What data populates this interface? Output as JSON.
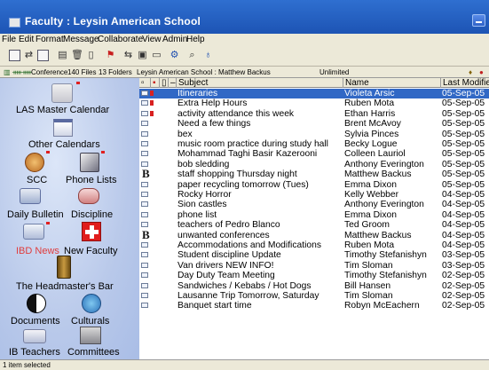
{
  "window": {
    "title": "Faculty : Leysin American School"
  },
  "menu": [
    "File",
    "Edit",
    "Format",
    "Message",
    "Collaborate",
    "View",
    "Admin",
    "Help"
  ],
  "toolbar": {
    "icons": [
      "new-message-icon",
      "reply-icon",
      "forward-icon",
      "print-icon",
      "delete-icon",
      "file-icon",
      "flag-icon",
      "move-icon",
      "archive-icon",
      "folder-icon",
      "settings-icon",
      "search-icon",
      "filter-icon"
    ]
  },
  "status": {
    "conference_label": "Conference",
    "files": "140 Files",
    "folders": "13 Folders",
    "location": "Leysin American School : Matthew Backus",
    "limit": "Unlimited"
  },
  "sidebar": {
    "items": [
      {
        "label": "LAS Master Calendar",
        "icon": "calendar-icon"
      },
      {
        "label": "Other Calendars",
        "icon": "calendar-icon"
      },
      {
        "label": "SCC",
        "icon": "medal-icon"
      },
      {
        "label": "Phone Lists",
        "icon": "phone-icon"
      },
      {
        "label": "Daily Bulletin",
        "icon": "bulletin-icon"
      },
      {
        "label": "Discipline",
        "icon": "discipline-icon"
      },
      {
        "label": "IBD News",
        "icon": "news-icon"
      },
      {
        "label": "New Faculty",
        "icon": "swiss-cross-icon"
      },
      {
        "label": "The Headmaster's Bar",
        "icon": "beer-icon"
      },
      {
        "label": "Documents",
        "icon": "yin-yang-icon"
      },
      {
        "label": "Culturals",
        "icon": "globe-icon"
      },
      {
        "label": "IB Teachers",
        "icon": "teachers-icon"
      },
      {
        "label": "Committees",
        "icon": "building-icon"
      }
    ],
    "highlight_color": "#e03c3c"
  },
  "list": {
    "columns": [
      "Subject",
      "Name",
      "Last Modifie"
    ],
    "rows": [
      {
        "subject": "Itineraries",
        "name": "Violeta Arsic",
        "date": "05-Sep-05",
        "selected": true,
        "flag": true,
        "type": "doc"
      },
      {
        "subject": "Extra Help Hours",
        "name": "Ruben Mota",
        "date": "05-Sep-05",
        "flag": true,
        "type": "doc"
      },
      {
        "subject": "activity attendance this week",
        "name": "Ethan Harris",
        "date": "05-Sep-05",
        "flag": true,
        "type": "doc"
      },
      {
        "subject": "Need a few things",
        "name": "Brent McAvoy",
        "date": "05-Sep-05",
        "type": "doc"
      },
      {
        "subject": "bex",
        "name": "Sylvia Pinces",
        "date": "05-Sep-05",
        "type": "doc"
      },
      {
        "subject": "music room practice during study hall",
        "name": "Becky Logue",
        "date": "05-Sep-05",
        "type": "doc"
      },
      {
        "subject": "Mohammad Taghi Basir Kazerooni",
        "name": "Colleen Lauriol",
        "date": "05-Sep-05",
        "type": "doc"
      },
      {
        "subject": "bob sledding",
        "name": "Anthony Everington",
        "date": "05-Sep-05",
        "type": "doc"
      },
      {
        "subject": "staff shopping Thursday night",
        "name": "Matthew Backus",
        "date": "05-Sep-05",
        "type": "b"
      },
      {
        "subject": "paper recycling tomorrow (Tues)",
        "name": "Emma Dixon",
        "date": "05-Sep-05",
        "type": "doc"
      },
      {
        "subject": "Rocky Horror",
        "name": "Kelly Webber",
        "date": "04-Sep-05",
        "type": "doc"
      },
      {
        "subject": "Sion castles",
        "name": "Anthony Everington",
        "date": "04-Sep-05",
        "type": "doc"
      },
      {
        "subject": "phone list",
        "name": "Emma Dixon",
        "date": "04-Sep-05",
        "type": "doc"
      },
      {
        "subject": "teachers of Pedro Blanco",
        "name": "Ted Groom",
        "date": "04-Sep-05",
        "type": "doc"
      },
      {
        "subject": "unwanted conferences",
        "name": "Matthew Backus",
        "date": "04-Sep-05",
        "type": "b"
      },
      {
        "subject": "Accommodations and Modifications",
        "name": "Ruben Mota",
        "date": "04-Sep-05",
        "type": "doc"
      },
      {
        "subject": "Student discipline Update",
        "name": "Timothy Stefanishyn",
        "date": "03-Sep-05",
        "type": "doc"
      },
      {
        "subject": "Van drivers NEW INFO!",
        "name": "Tim Sloman",
        "date": "03-Sep-05",
        "type": "doc"
      },
      {
        "subject": "Day Duty Team Meeting",
        "name": "Timothy Stefanishyn",
        "date": "02-Sep-05",
        "type": "doc"
      },
      {
        "subject": "Sandwiches / Kebabs / Hot Dogs",
        "name": "Bill Hansen",
        "date": "02-Sep-05",
        "type": "doc"
      },
      {
        "subject": "Lausanne Trip Tomorrow, Saturday",
        "name": "Tim Sloman",
        "date": "02-Sep-05",
        "type": "doc"
      },
      {
        "subject": "Banquet start time",
        "name": "Robyn McEachern",
        "date": "02-Sep-05",
        "type": "doc"
      }
    ]
  },
  "footer": {
    "text": "1 item selected"
  },
  "colors": {
    "selection": "#3168c5",
    "titlebar": "#1d54b4",
    "flag": "#d82020"
  }
}
